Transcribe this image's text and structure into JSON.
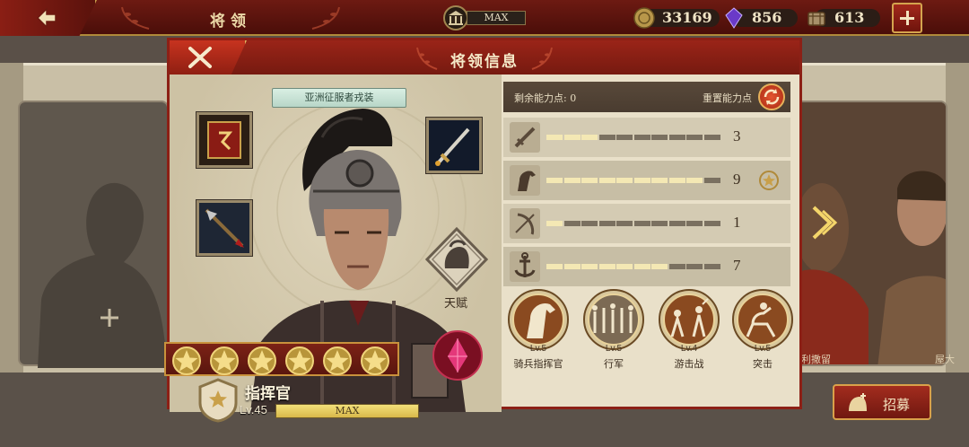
{
  "topbar": {
    "title": "将领",
    "building_level": "MAX",
    "resources": [
      {
        "icon": "coin-icon",
        "value": "33169"
      },
      {
        "icon": "purple-gem-icon",
        "value": "856"
      },
      {
        "icon": "supplies-icon",
        "value": "613"
      }
    ]
  },
  "dialog": {
    "title": "将领信息",
    "skin_name": "亚洲征服者戎装",
    "talent_label": "天赋",
    "stars": 6,
    "rank_name": "指挥官",
    "level_text": "Lv.45",
    "level_bar_label": "MAX",
    "level_progress": 1.0
  },
  "stats": {
    "remaining_label": "剩余能力点: 0",
    "reset_label": "重置能力点",
    "rows": [
      {
        "icon": "sword-icon",
        "filled": 3,
        "total": 10,
        "value": "3"
      },
      {
        "icon": "horse-icon",
        "filled": 9,
        "total": 10,
        "value": "9"
      },
      {
        "icon": "bow-icon",
        "filled": 1,
        "total": 10,
        "value": "1"
      },
      {
        "icon": "anchor-icon",
        "filled": 7,
        "total": 10,
        "value": "7"
      }
    ]
  },
  "skills": [
    {
      "level": "Lv.5",
      "name": "骑兵指挥官",
      "icon": "cavalry-commander-icon"
    },
    {
      "level": "Lv.5",
      "name": "行军",
      "icon": "march-icon"
    },
    {
      "level": "Lv.4",
      "name": "游击战",
      "icon": "guerrilla-icon"
    },
    {
      "level": "Lv.5",
      "name": "突击",
      "icon": "assault-icon"
    }
  ],
  "background": {
    "right_card_names": [
      "利撒留",
      "屋大"
    ],
    "recruit_label": "招募"
  },
  "colors": {
    "accent_red": "#8c2016",
    "gold": "#d4a44e",
    "panel": "#e9e0c9"
  }
}
